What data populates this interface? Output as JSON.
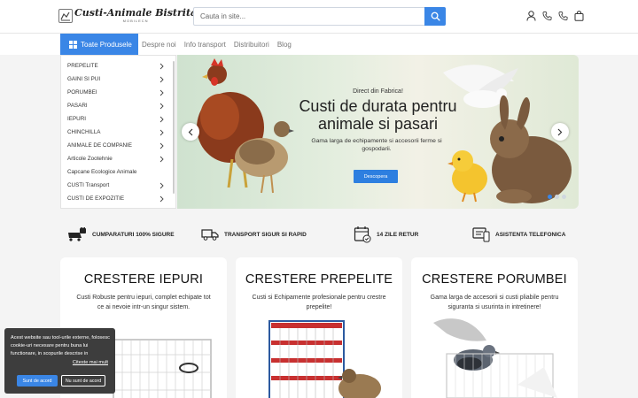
{
  "header": {
    "logo_title": "Custi-Animale Bistrita",
    "logo_subtitle": "MOBILECN",
    "search_placeholder": "Cauta in site...",
    "icons": [
      "user-icon",
      "phone-icon",
      "phone-icon",
      "shopping-bag-icon"
    ]
  },
  "nav": {
    "all_products": "Toate Produsele",
    "links": [
      "Despre noi",
      "Info transport",
      "Distribuitori",
      "Blog"
    ]
  },
  "sidebar": {
    "items": [
      {
        "label": "PREPELITE",
        "has_submenu": true
      },
      {
        "label": "GAINI SI PUI",
        "has_submenu": true
      },
      {
        "label": "PORUMBEI",
        "has_submenu": true
      },
      {
        "label": "PASARI",
        "has_submenu": true
      },
      {
        "label": "IEPURI",
        "has_submenu": true
      },
      {
        "label": "CHINCHILLA",
        "has_submenu": true
      },
      {
        "label": "ANIMALE DE COMPANIE",
        "has_submenu": true
      },
      {
        "label": "Articole Zootehnie",
        "has_submenu": true
      },
      {
        "label": "Capcane Ecologice Animale",
        "has_submenu": false
      },
      {
        "label": "CUSTI Transport",
        "has_submenu": true
      },
      {
        "label": "CUSTI DE EXPOZITIE",
        "has_submenu": true
      }
    ]
  },
  "banner": {
    "tagline": "Direct din Fabrica!",
    "title_line1": "Custi de durata pentru",
    "title_line2": "animale si pasari",
    "description": "Gama larga de echipamente si accesorii ferme si gospodarii.",
    "button": "Descopera",
    "slide_active": 1,
    "slide_count": 3
  },
  "features": [
    {
      "label": "CUMPARATURI 100% SIGURE",
      "icon": "secure-shopping-icon"
    },
    {
      "label": "TRANSPORT SIGUR SI RAPID",
      "icon": "truck-icon"
    },
    {
      "label": "14 ZILE RETUR",
      "icon": "calendar-icon"
    },
    {
      "label": "ASISTENTA TELEFONICA",
      "icon": "support-icon"
    }
  ],
  "categories": [
    {
      "title": "CRESTERE IEPURI",
      "description": "Custi Robuste pentru iepuri, complet echipate tot ce ai nevoie intr-un singur sistem."
    },
    {
      "title": "CRESTERE PREPELITE",
      "description": "Custi si Echipamente profesionale pentru crestre prepelite!"
    },
    {
      "title": "CRESTERE PORUMBEI",
      "description": "Gama larga de accesorii si custi pliabile pentru siguranta si usurinta in intretinere!"
    }
  ],
  "cookie": {
    "text": "Acest website sau tool-urile externe, folosesc cookie-uri necesare pentru buna lui functionare, in scopurile descrise in",
    "link": "Citeste mai mult",
    "accept": "Sunt de acord",
    "decline": "Nu sunt de acord"
  },
  "colors": {
    "accent": "#3a86e6",
    "cookie_bg": "#3d3d3d"
  }
}
